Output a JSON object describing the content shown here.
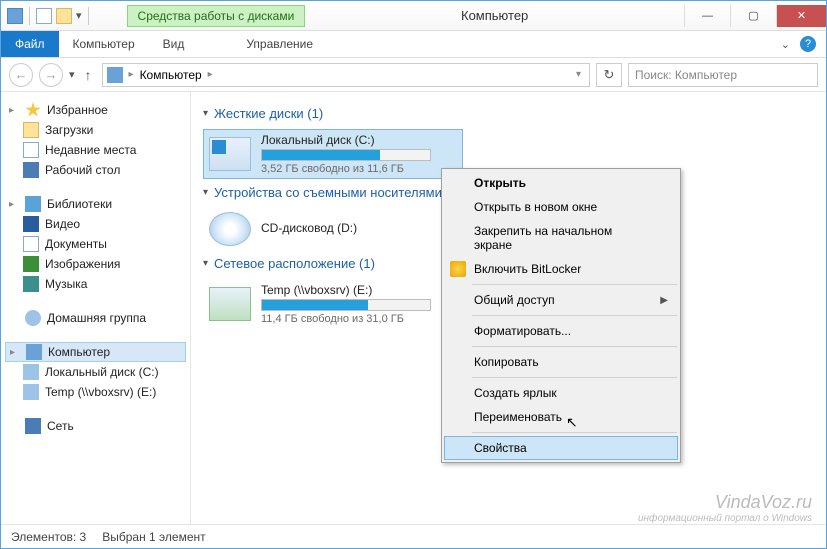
{
  "titlebar": {
    "tools_tab": "Средства работы с дисками",
    "title": "Компьютер"
  },
  "ribbon": {
    "file": "Файл",
    "computer": "Компьютер",
    "view": "Вид",
    "manage": "Управление"
  },
  "nav": {
    "breadcrumb": "Компьютер",
    "search_placeholder": "Поиск: Компьютер"
  },
  "sidebar": {
    "favorites": {
      "header": "Избранное",
      "items": [
        "Загрузки",
        "Недавние места",
        "Рабочий стол"
      ]
    },
    "libraries": {
      "header": "Библиотеки",
      "items": [
        "Видео",
        "Документы",
        "Изображения",
        "Музыка"
      ]
    },
    "homegroup": "Домашняя группа",
    "computer": {
      "header": "Компьютер",
      "items": [
        "Локальный диск (C:)",
        "Temp (\\\\vboxsrv) (E:)"
      ]
    },
    "network": "Сеть"
  },
  "content": {
    "cat_hdd": "Жесткие диски (1)",
    "cat_removable": "Устройства со съемными носителями",
    "cat_network": "Сетевое расположение (1)",
    "drives": {
      "c": {
        "name": "Локальный диск (C:)",
        "sub": "3,52 ГБ свободно из 11,6 ГБ",
        "fill_pct": 70
      },
      "d": {
        "name": "CD-дисковод (D:)"
      },
      "e": {
        "name": "Temp (\\\\vboxsrv) (E:)",
        "sub": "11,4 ГБ свободно из 31,0 ГБ",
        "fill_pct": 63
      }
    }
  },
  "context_menu": {
    "open": "Открыть",
    "open_new": "Открыть в новом окне",
    "pin_start": "Закрепить на начальном экране",
    "bitlocker": "Включить BitLocker",
    "share": "Общий доступ",
    "format": "Форматировать...",
    "copy": "Копировать",
    "shortcut": "Создать ярлык",
    "rename": "Переименовать",
    "properties": "Свойства"
  },
  "statusbar": {
    "count": "Элементов: 3",
    "selected": "Выбран 1 элемент"
  },
  "watermark": {
    "l1": "VindaVoz.ru",
    "l2": "информационный портал о Windows"
  }
}
